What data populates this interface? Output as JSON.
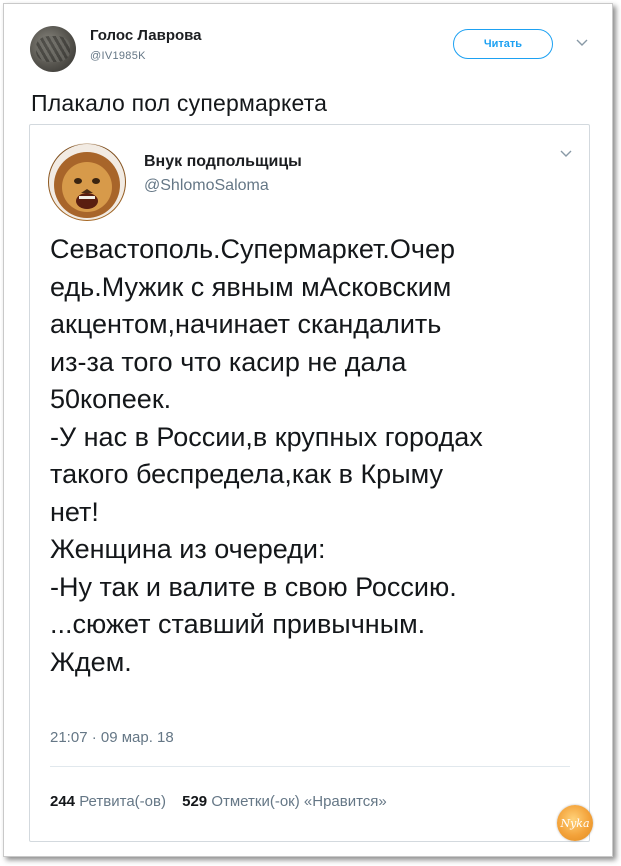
{
  "outer_tweet": {
    "author_name": "Голос Лаврова",
    "author_handle": "@IV1985K",
    "follow_label": "Читать",
    "text": "Плакало пол супермаркета"
  },
  "quoted_tweet": {
    "author_name": "Внук подпольщицы",
    "author_handle": "@ShlomoSaloma",
    "body": "Севастополь.Супермаркет.Очер\nедь.Мужик с явным мАсковским\nакцентом,начинает скандалить\nиз-за того что касир не дала\n50копеек.\n-У нас в России,в крупных городах\nтакого беспредела,как в Крыму\nнет!\nЖенщина из очереди:\n-Ну так и валите в свою Россию.\n...сюжет ставший привычным.\nЖдем.",
    "timestamp": "21:07 · 09 мар. 18",
    "retweets_count": "244",
    "retweets_label": "Ретвита(-ов)",
    "likes_count": "529",
    "likes_label": "Отметки(-ок) «Нравится»"
  },
  "watermark_text": "Nyka",
  "colors": {
    "accent": "#1da1f2",
    "secondary_text": "#657786",
    "primary_text": "#14171a"
  },
  "icons": {
    "menu": "chevron-down-icon"
  }
}
